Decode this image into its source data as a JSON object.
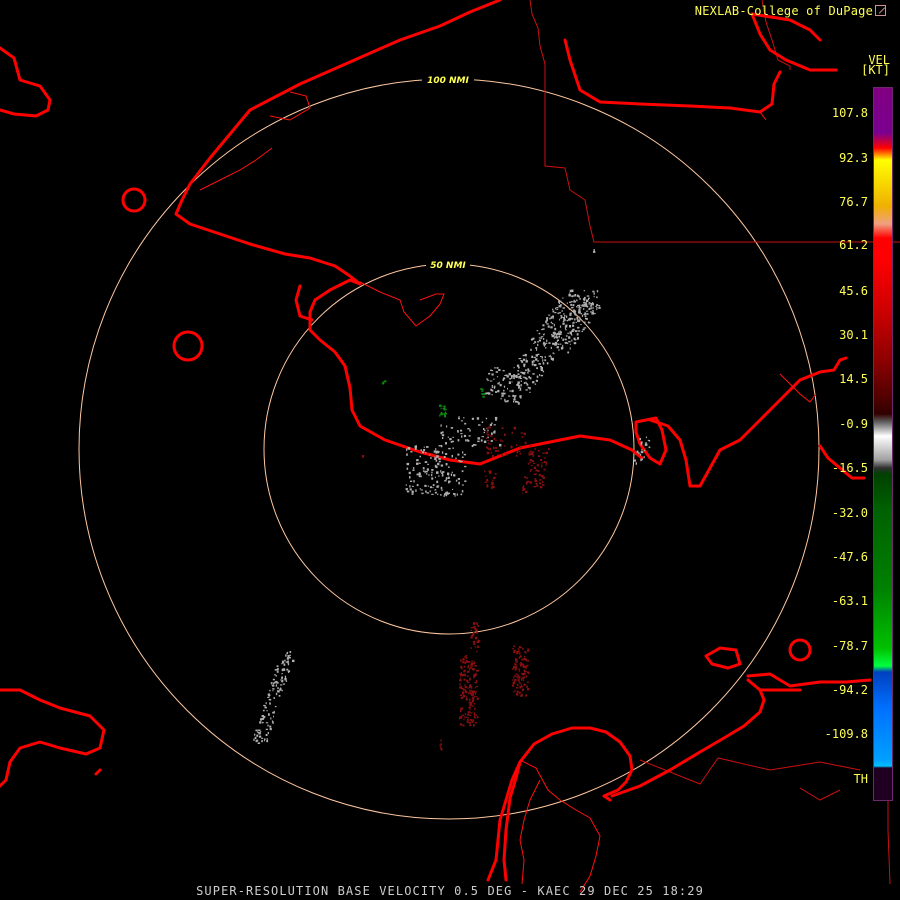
{
  "credit": "NEXLAB-College of DuPage",
  "legend": {
    "product": "VEL",
    "unit": "[KT]",
    "labels": [
      "107.8",
      "92.3",
      "76.7",
      "61.2",
      "45.6",
      "30.1",
      "14.5",
      "-0.9",
      "-16.5",
      "-32.0",
      "-47.6",
      "-63.1",
      "-78.7",
      "-94.2",
      "-109.8",
      "TH"
    ]
  },
  "rings": {
    "inner_label": "50 NMI",
    "outer_label": "100 NMI"
  },
  "footer": "SUPER-RESOLUTION BASE VELOCITY 0.5 DEG - KAEC 29 DEC 25 18:29",
  "colors": {
    "boundary": "#ff0000",
    "ring": "#ffc8a0",
    "label_text": "#ffff55",
    "footer_text": "#cccccc",
    "inbound_green": "#0a8a0a",
    "outbound_red": "#8a1010",
    "near_zero_gray": "#b0b0b0"
  }
}
